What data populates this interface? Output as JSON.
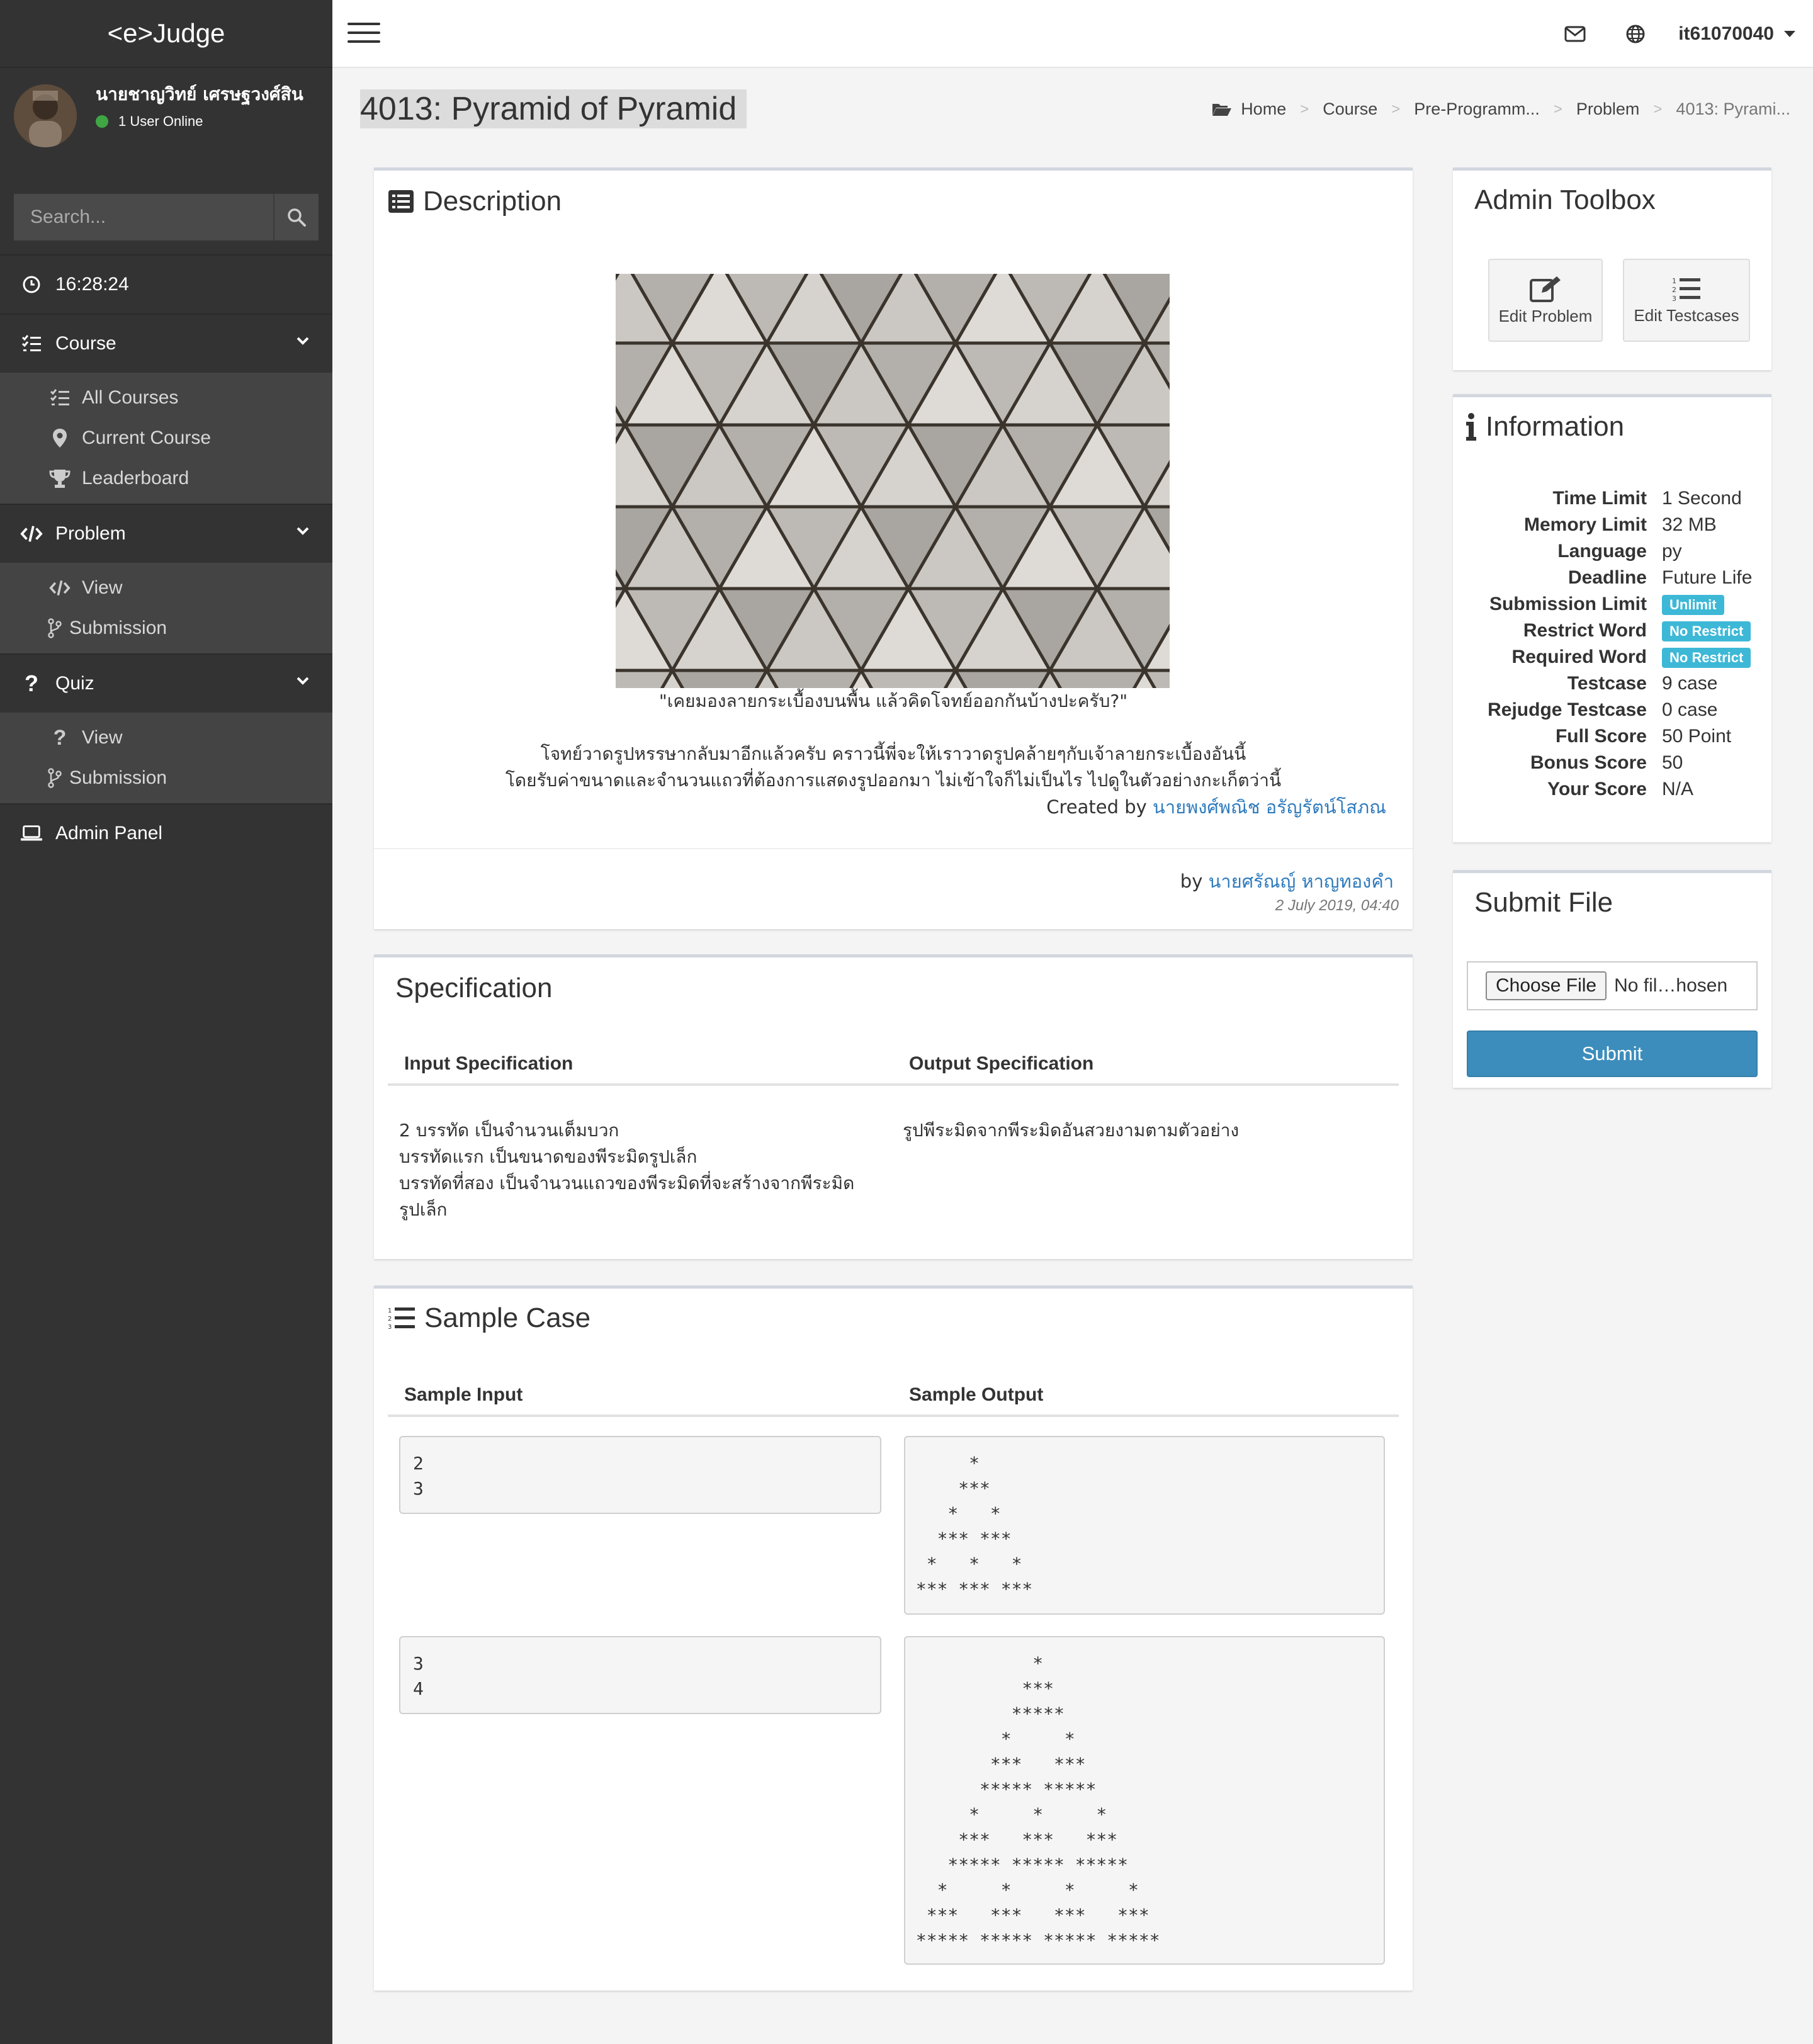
{
  "app": {
    "brand": "<e>Judge"
  },
  "user": {
    "name": "นายชาญวิทย์ เศรษฐวงศ์สิน",
    "status": "1 User Online"
  },
  "search": {
    "placeholder": "Search..."
  },
  "clock": "16:28:24",
  "sidebar": {
    "course": {
      "label": "Course",
      "items": [
        "All Courses",
        "Current Course",
        "Leaderboard"
      ]
    },
    "problem": {
      "label": "Problem",
      "items": [
        "View",
        "Submission"
      ]
    },
    "quiz": {
      "label": "Quiz",
      "items": [
        "View",
        "Submission"
      ]
    },
    "admin": "Admin Panel"
  },
  "topbar": {
    "username": "it61070040"
  },
  "page": {
    "title": "4013: Pyramid of Pyramid"
  },
  "breadcrumb": [
    "Home",
    "Course",
    "Pre-Programm...",
    "Problem",
    "4013: Pyrami..."
  ],
  "description": {
    "title": "Description",
    "quote": "\"เคยมองลายกระเบื้องบนพื้น แล้วคิดโจทย์ออกกันบ้างปะครับ?\"",
    "line1": "โจทย์วาดรูปหรรษากลับมาอีกแล้วครับ คราวนี้พี่จะให้เราวาดรูปคล้ายๆกับเจ้าลายกระเบื้องอันนี้",
    "line2": "โดยรับค่าขนาดและจำนวนแถวที่ต้องการแสดงรูปออกมา ไม่เข้าใจก็ไม่เป็นไร ไปดูในตัวอย่างกะเก็ตว่านี้",
    "created_prefix": "Created by",
    "created_by": "นายพงศ์พณิช อรัญรัตน์โสภณ",
    "by_prefix": "by",
    "author": "นายศรัณญ์ หาญทองคำ",
    "date": "2 July 2019, 04:40"
  },
  "specification": {
    "title": "Specification",
    "input_header": "Input Specification",
    "output_header": "Output Specification",
    "input_lines": [
      "2 บรรทัด เป็นจำนวนเต็มบวก",
      "บรรทัดแรก เป็นขนาดของพีระมิดรูปเล็ก",
      "บรรทัดที่สอง เป็นจำนวนแถวของพีระมิดที่จะสร้างจากพีระมิด",
      "รูปเล็ก"
    ],
    "output_text": "รูปพีระมิดจากพีระมิดอันสวยงามตามตัวอย่าง"
  },
  "sample": {
    "title": "Sample Case",
    "input_header": "Sample Input",
    "output_header": "Sample Output",
    "cases": [
      {
        "input": "2\n3",
        "output": "      *\n     ***\n    *   *\n   *** ***\n  *   *   *\n *** *** ***"
      },
      {
        "input": "3\n4",
        "output": "            *\n           ***\n          *****\n         *     *\n        ***   ***\n       ***** *****\n      *     *     *\n     ***   ***   ***\n    ***** ***** *****\n   *     *     *     *\n  ***   ***   ***   ***\n ***** ***** ***** *****"
      }
    ]
  },
  "admin_toolbox": {
    "title": "Admin Toolbox",
    "edit_problem": "Edit Problem",
    "edit_testcases": "Edit Testcases"
  },
  "information": {
    "title": "Information",
    "rows": [
      {
        "key": "Time Limit",
        "value": "1 Second"
      },
      {
        "key": "Memory Limit",
        "value": "32 MB"
      },
      {
        "key": "Language",
        "value": "py"
      },
      {
        "key": "Deadline",
        "value": "Future Life"
      },
      {
        "key": "Submission Limit",
        "value": "Unlimit",
        "badge": true
      },
      {
        "key": "Restrict Word",
        "value": "No Restrict",
        "badge": true
      },
      {
        "key": "Required Word",
        "value": "No Restrict",
        "badge": true
      },
      {
        "key": "Testcase",
        "value": "9 case"
      },
      {
        "key": "Rejudge Testcase",
        "value": "0 case"
      },
      {
        "key": "Full Score",
        "value": "50 Point"
      },
      {
        "key": "Bonus Score",
        "value": "50"
      },
      {
        "key": "Your Score",
        "value": "N/A"
      }
    ]
  },
  "submit": {
    "title": "Submit File",
    "choose_label": "Choose File",
    "file_status": "No fil…hosen",
    "button": "Submit"
  },
  "colors": {
    "sidebar": "#333333",
    "accent": "#3c8dbc",
    "badge": "#3db8d6",
    "link": "#2f7bbd",
    "online": "#3fa644"
  }
}
